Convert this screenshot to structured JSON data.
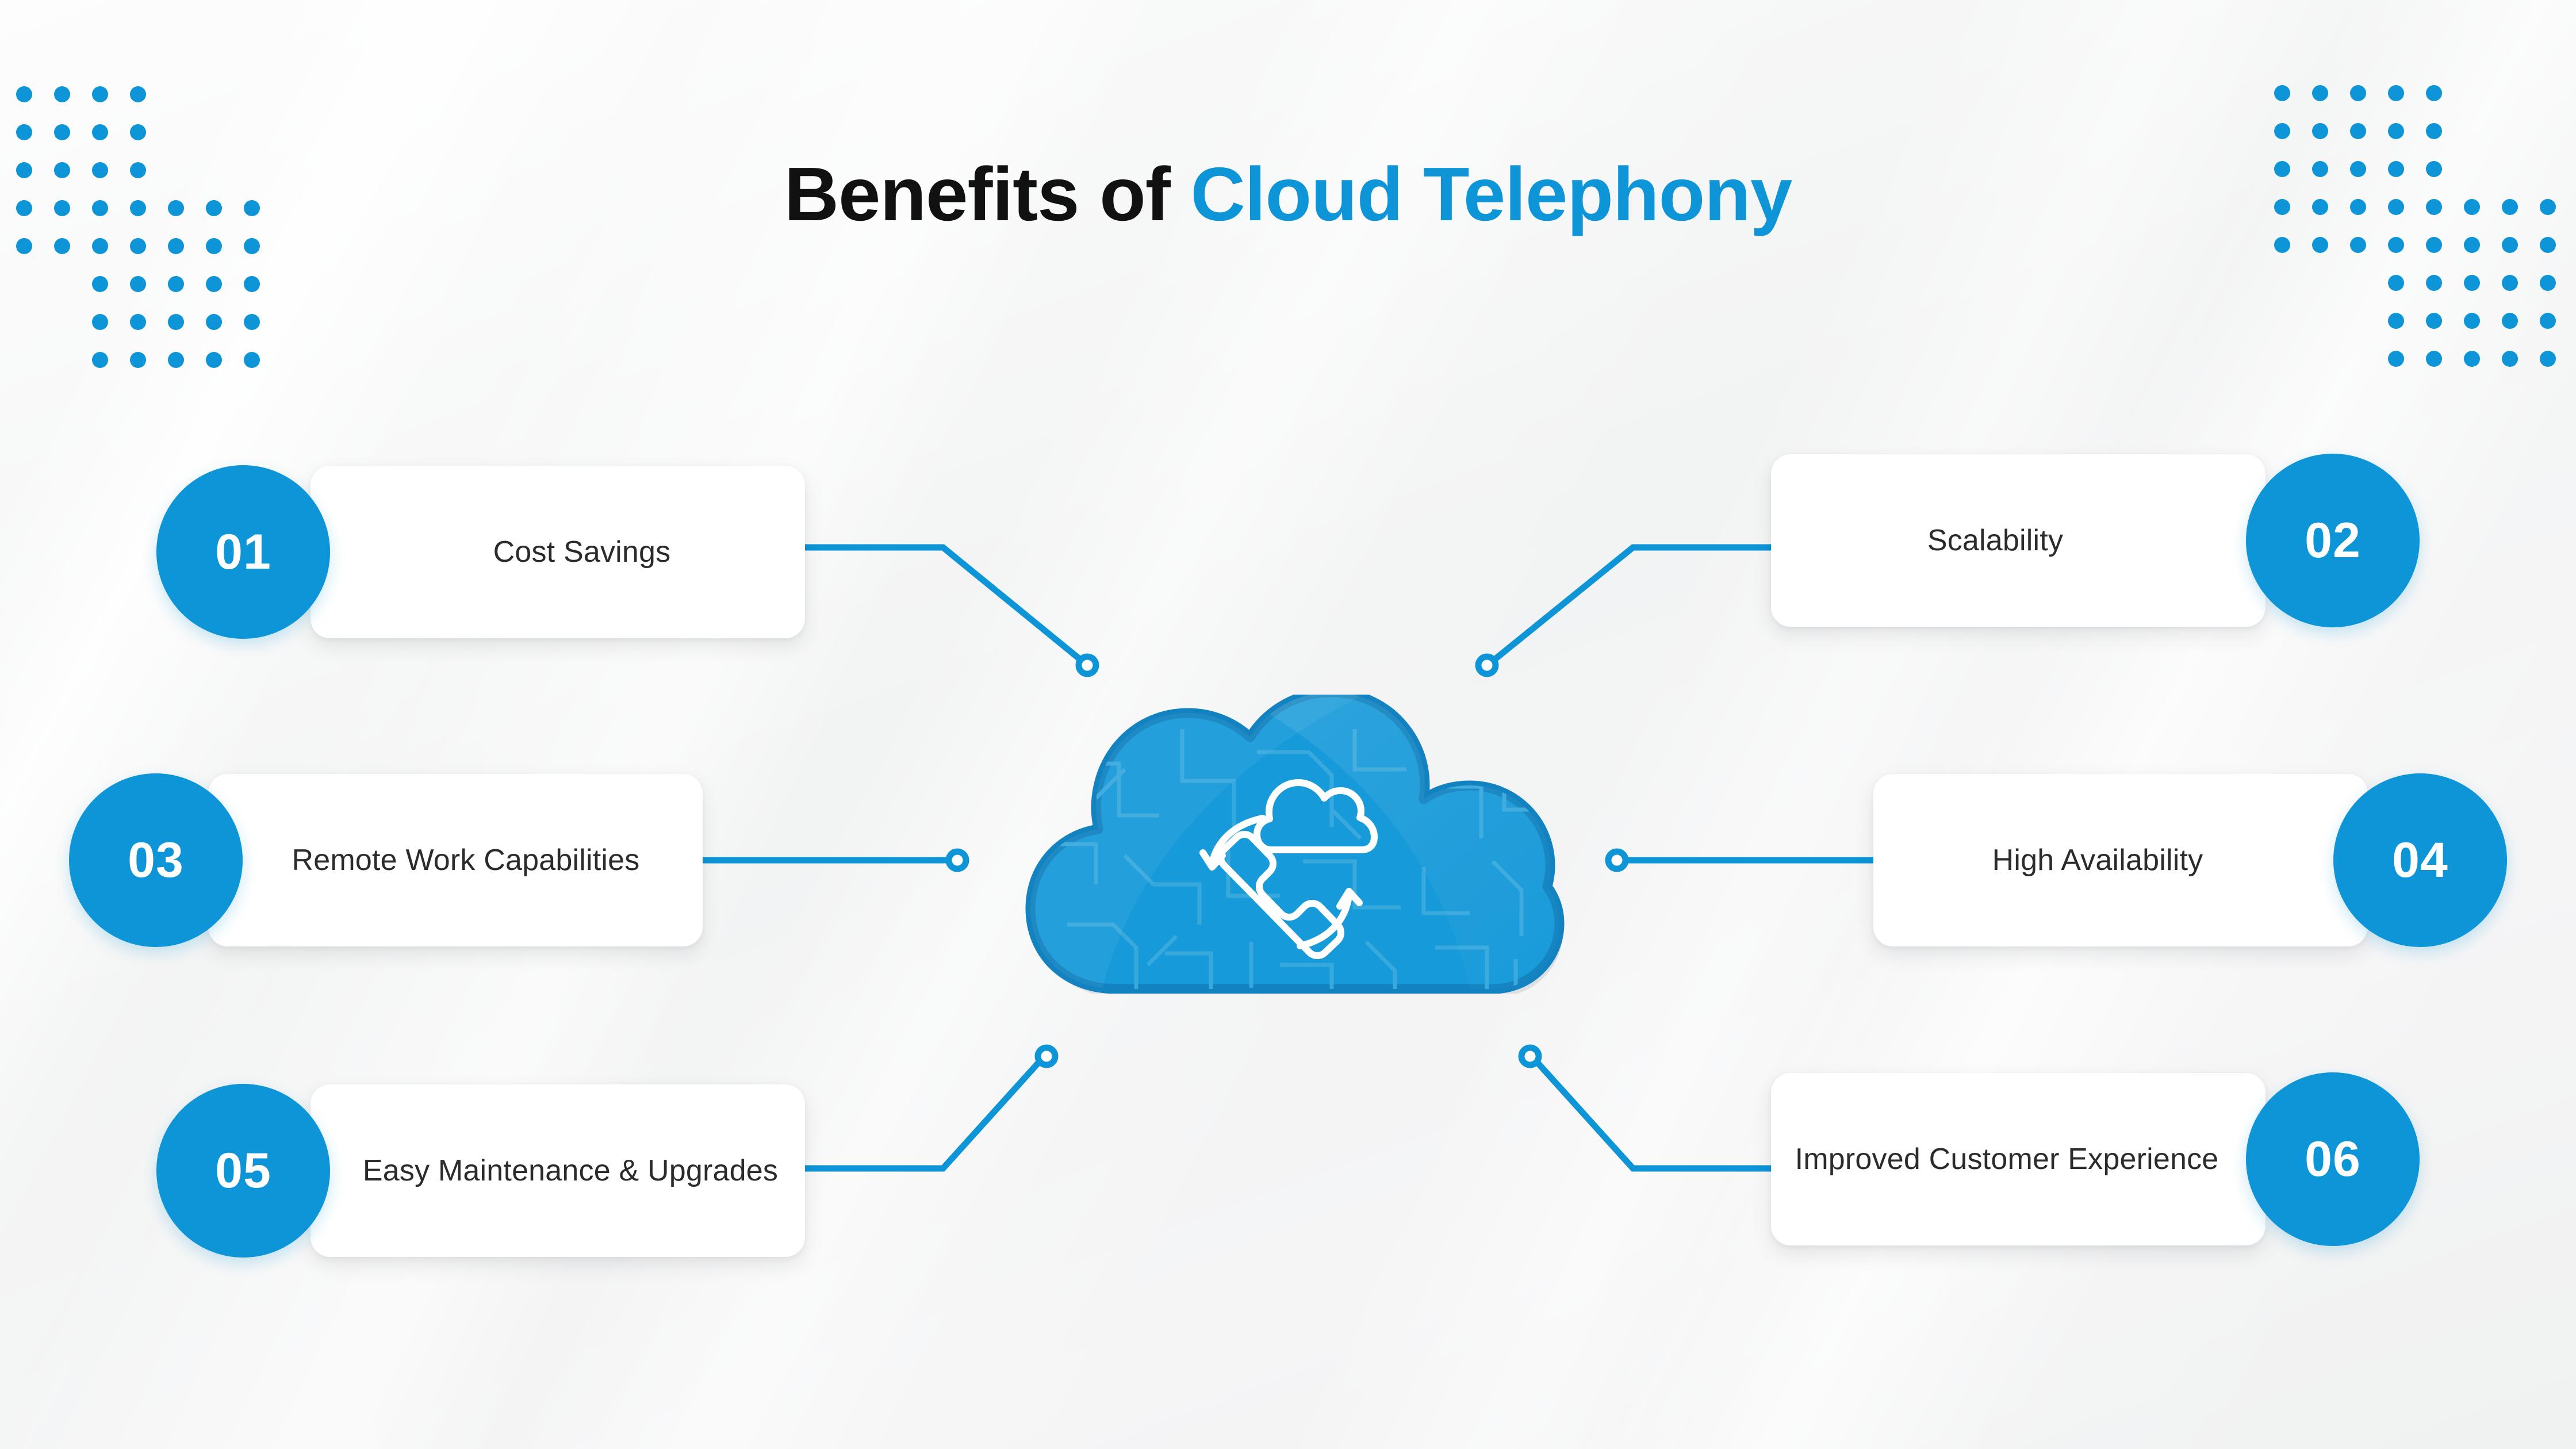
{
  "title": {
    "lead": "Benefits of",
    "accent": "Cloud Telephony",
    "full": "Benefits of Cloud Telephony"
  },
  "theme": {
    "accent_blue": "#0d95d8",
    "cloud_fill": "#179ad9",
    "cloud_outline": "#1283c0",
    "background": "#f3f4f4",
    "card_bg": "#ffffff",
    "text_dark": "#2b2b2b",
    "title_dark": "#111111",
    "connector_line": "#0d95d8"
  },
  "center": {
    "icon_name": "cloud-telephony-icon",
    "description": "Cloud with phone handset and sync arrows"
  },
  "benefits": [
    {
      "number": "01",
      "label": "Cost Savings",
      "side": "left"
    },
    {
      "number": "02",
      "label": "Scalability",
      "side": "right"
    },
    {
      "number": "03",
      "label": "Remote Work Capabilities",
      "side": "left"
    },
    {
      "number": "04",
      "label": "High Availability",
      "side": "right"
    },
    {
      "number": "05",
      "label": "Easy Maintenance & Upgrades",
      "side": "left"
    },
    {
      "number": "06",
      "label": "Improved Customer Experience",
      "side": "right"
    }
  ],
  "decorations": {
    "top_left_dots": "dot-grid-staircase",
    "top_right_dots": "dot-grid-staircase"
  }
}
